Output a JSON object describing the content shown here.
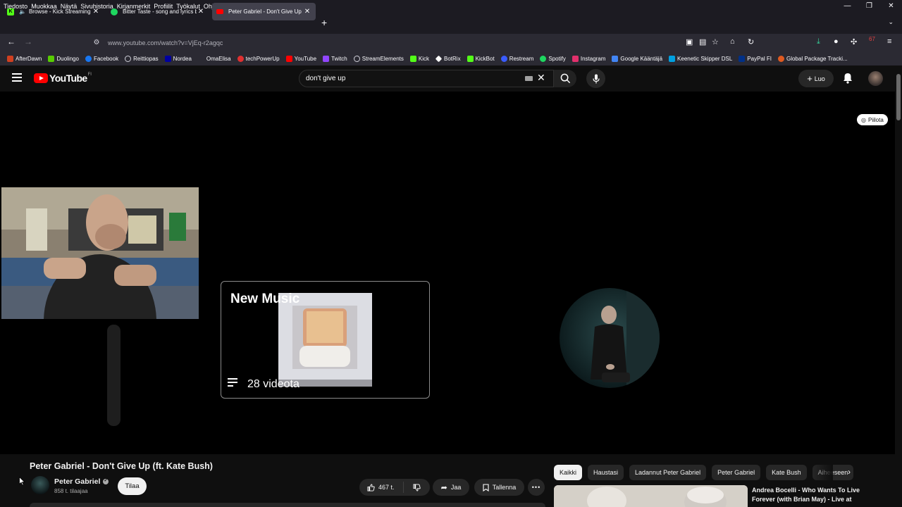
{
  "browser": {
    "menu": [
      "Tiedosto",
      "Muokkaa",
      "Näytä",
      "Sivuhistoria",
      "Kirjanmerkit",
      "Profiilit",
      "Työkalut",
      "Ohje"
    ],
    "tabs": [
      {
        "title": "Browse - Kick Streaming",
        "favicon_color": "#53fc18"
      },
      {
        "title": "Bitter Taste - song and lyrics by",
        "favicon_color": "#1ed760"
      },
      {
        "title": "Peter Gabriel - Don't Give Up (ft.",
        "favicon_color": "#ff0000"
      }
    ],
    "url": "www.youtube.com/watch?v=VjEq-r2agqc",
    "extension_badge": "67",
    "bookmarks": [
      {
        "label": "AfterDawn",
        "color": "#d04020"
      },
      {
        "label": "Duolingo",
        "color": "#58cc02"
      },
      {
        "label": "Facebook",
        "color": "#1877f2"
      },
      {
        "label": "Reittiopas",
        "color": "#cfcfd8"
      },
      {
        "label": "Nordea",
        "color": "#0000a0"
      },
      {
        "label": "OmaElisa",
        "color": "#2b2a33"
      },
      {
        "label": "techPowerUp",
        "color": "#e03030"
      },
      {
        "label": "YouTube",
        "color": "#ff0000"
      },
      {
        "label": "Twitch",
        "color": "#9146ff"
      },
      {
        "label": "StreamElements",
        "color": "#cfcfd8"
      },
      {
        "label": "Kick",
        "color": "#53fc18"
      },
      {
        "label": "BotRix",
        "color": "#ffffff"
      },
      {
        "label": "KickBot",
        "color": "#53fc18"
      },
      {
        "label": "Restream",
        "color": "#3a5cff"
      },
      {
        "label": "Spotify",
        "color": "#1ed760"
      },
      {
        "label": "Instagram",
        "color": "#e1306c"
      },
      {
        "label": "Google Kääntäjä",
        "color": "#4285f4"
      },
      {
        "label": "Keenetic Skipper DSL",
        "color": "#00a0e0"
      },
      {
        "label": "PayPal FI",
        "color": "#003087"
      },
      {
        "label": "Global Package Tracki...",
        "color": "#e05a20"
      }
    ]
  },
  "youtube": {
    "logo_text": "YouTube",
    "region": "FI",
    "search_query": "don't give up",
    "create_label": "Luo",
    "hide_label": "Piilota",
    "endscreen": {
      "playlist_title": "New Music",
      "playlist_count": "28 videota"
    },
    "video": {
      "title": "Peter Gabriel - Don't Give Up (ft. Kate Bush)",
      "channel": "Peter Gabriel",
      "subscribers": "858 t. tilaajaa",
      "subscribe_label": "Tilaa",
      "likes": "467 t.",
      "share_label": "Jaa",
      "save_label": "Tallenna"
    },
    "chips": [
      "Kaikki",
      "Haustasi",
      "Ladannut Peter Gabriel",
      "Peter Gabriel",
      "Kate Bush",
      "Aiheeseen"
    ],
    "recommendation": {
      "title": "Andrea Bocelli - Who Wants To Live Forever (with Brian May) - Live at"
    }
  }
}
